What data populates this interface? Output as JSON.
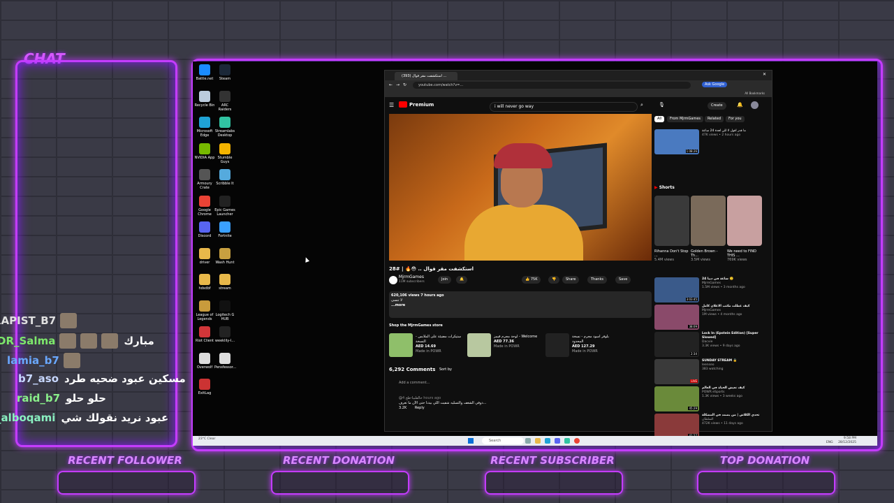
{
  "overlay": {
    "chat_title": "CHAT",
    "chat": [
      {
        "user": "RAPIST_B7",
        "msg": "",
        "color": "#e0e0e0"
      },
      {
        "user": "DR_Salma",
        "msg": "مبارك",
        "color": "#7de86b"
      },
      {
        "user": "lamia_b7",
        "msg": "",
        "color": "#6aa8ff"
      },
      {
        "user": "b7_aso",
        "msg": "مسكين عبود ضحيه طرد",
        "color": "#c8d8ff"
      },
      {
        "user": "raid_b7",
        "msg": "حلو حلو",
        "color": "#8af08a"
      },
      {
        "user": "_alboqami",
        "msg": "عبود نريد نقولك شي",
        "color": "#8af0c0"
      }
    ],
    "bottom": [
      "RECENT FOLLOWER",
      "RECENT DONATION",
      "RECENT SUBSCRIBER",
      "TOP DONATION"
    ]
  },
  "desktop": {
    "icons": [
      {
        "label": "Battle.net",
        "color": "#1a8cff"
      },
      {
        "label": "Steam",
        "color": "#1b2838"
      },
      {
        "label": "Recycle Bin",
        "color": "#bcd"
      },
      {
        "label": "ARC Raiders",
        "color": "#333"
      },
      {
        "label": "Microsoft Edge",
        "color": "#1fa3d6"
      },
      {
        "label": "Streamlabs Desktop",
        "color": "#31c3a2"
      },
      {
        "label": "NVIDIA App",
        "color": "#76b900"
      },
      {
        "label": "Stumble Guys",
        "color": "#f4b400"
      },
      {
        "label": "Armoury Crate",
        "color": "#555"
      },
      {
        "label": "Scribble It",
        "color": "#5ad"
      },
      {
        "label": "Google Chrome",
        "color": "#ea4335"
      },
      {
        "label": "Epic Games Launcher",
        "color": "#222"
      },
      {
        "label": "Discord",
        "color": "#5865f2"
      },
      {
        "label": "Fortnite",
        "color": "#3aa0ff"
      },
      {
        "label": "driver",
        "color": "#e8b84a"
      },
      {
        "label": "Wash Hunt",
        "color": "#c8a040"
      },
      {
        "label": "hdsdbf",
        "color": "#e8b84a"
      },
      {
        "label": "stream",
        "color": "#e8b84a"
      },
      {
        "label": "League of Legends",
        "color": "#c89b3c"
      },
      {
        "label": "Logitech G HUB",
        "color": "#111"
      },
      {
        "label": "Riot Client",
        "color": "#d13639"
      },
      {
        "label": "weeklily-l...",
        "color": "#222"
      },
      {
        "label": "Overwolf",
        "color": "#ddd"
      },
      {
        "label": "Pensfessor...",
        "color": "#ddd"
      },
      {
        "label": "ExitLag",
        "color": "#c33"
      }
    ]
  },
  "browser": {
    "tab_title": "(393) استكشفت مقر قوال ...",
    "url": "youtube.com/watch?v=...",
    "ask_google": "Ask Google",
    "all_bookmarks": "All Bookmarks",
    "search_query": "i will never go way",
    "create_label": "Create",
    "premium_label": "Premium"
  },
  "video": {
    "title": "استكشفت مقر قوال .. 😳🔥 | #28",
    "channel": "MjrmGames",
    "subscribers": "11M subscribers",
    "join": "Join",
    "likes": "75K",
    "share": "Share",
    "thanks": "Thanks",
    "save": "Save",
    "views": "620,106 views  7 hours ago",
    "desc_line1": "لا تنسى",
    "desc_line2": "...more",
    "shop_title": "Shop the MjrmGames store",
    "shop": [
      {
        "title": "ستيكرات مضيئة على الملابس - النسخة",
        "price": "AED 14.69",
        "src": "Made in POWR"
      },
      {
        "title": "لوحة مجرم قيمز - Welcome",
        "price": "AED 77.36",
        "src": "Made in POWR"
      },
      {
        "title": "بلوفر اسود مجرم - نسخة المحدود",
        "price": "AED 127.29",
        "src": "Made in POWR"
      }
    ],
    "comments_count": "6,292 Comments",
    "sort_by": "Sort by",
    "add_comment": "Add a comment...",
    "comment_user": "@حالفلبيا-طح",
    "comment_time": "4 hours ago",
    "comment_text": "دوقي الشغف والتسليه شفيت اللي بيدنا حتى الآن ما تعرف...",
    "comment_likes": "3.2K",
    "reply": "Reply"
  },
  "rail": {
    "chips": [
      "All",
      "From MjrmGames",
      "Related",
      "For you"
    ],
    "top": {
      "title": "ما قدر اقول لا للي لعدة 24 ساعة",
      "meta": "47K views • 2 hours ago",
      "dur": "1:08:26"
    },
    "shorts_title": "Shorts",
    "shorts": [
      {
        "title": "Rihanna Don't Stop ...",
        "views": "5.4M views"
      },
      {
        "title": "Golden Brown - Th...",
        "views": "3.5M views"
      },
      {
        "title": "We need to FIND THIS ...",
        "views": "769K views"
      }
    ],
    "videos": [
      {
        "title": "24 ساعة في دبيا 🙂",
        "channel": "MjrmGames",
        "meta": "1.5M views • 3 months ago",
        "dur": "3:03:45"
      },
      {
        "title": "كيف عطلت مكتب الاعلان كامل",
        "channel": "MjrmGames",
        "meta": "1M views • 4 months ago",
        "dur": "38:09"
      },
      {
        "title": "Lock In (Epstein Edition) [Super Slowed]",
        "channel": "Dacvie",
        "meta": "3.3K views • 9 days ago",
        "dur": "2:34"
      },
      {
        "title": "SUNDAY STREAM 🔒",
        "channel": "leenseo",
        "meta": "383 watching",
        "dur": "LIVE"
      },
      {
        "title": "كيف نعيش الحياة في العالم",
        "channel": "POWR eSports",
        "meta": "1.3K views • 3 weeks ago",
        "dur": "45:29"
      },
      {
        "title": "تحدي الكلاش | من يصمد في المشكلة",
        "channel": "السلطان",
        "meta": "472K views • 11 days ago",
        "dur": "41:27"
      }
    ]
  },
  "taskbar": {
    "weather": "23°C Clear",
    "search": "Search",
    "lang": "ENG",
    "time": "9:58 PM",
    "date": "28/12/2025"
  }
}
